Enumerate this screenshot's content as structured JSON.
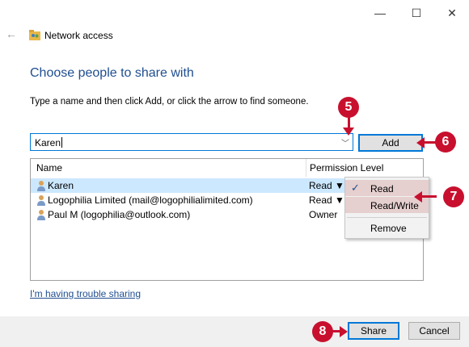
{
  "window": {
    "title": "Network access",
    "controls": {
      "minimize": "—",
      "maximize": "☐",
      "close": "✕"
    }
  },
  "heading": "Choose people to share with",
  "instruction": "Type a name and then click Add, or click the arrow to find someone.",
  "name_input": {
    "value": "Karen"
  },
  "add_button": "Add",
  "list": {
    "columns": [
      "Name",
      "Permission Level"
    ],
    "rows": [
      {
        "name": "Karen",
        "permission": "Read ▼"
      },
      {
        "name": "Logophilia Limited (mail@logophilialimited.com)",
        "permission": "Read ▼"
      },
      {
        "name": "Paul M (logophilia@outlook.com)",
        "permission": "Owner"
      }
    ]
  },
  "permission_menu": {
    "items": [
      "Read",
      "Read/Write",
      "Remove"
    ],
    "checked": "Read"
  },
  "trouble_link": "I'm having trouble sharing",
  "footer": {
    "share": "Share",
    "cancel": "Cancel"
  },
  "callouts": [
    "5",
    "6",
    "7",
    "8"
  ],
  "colors": {
    "accent": "#0078d7",
    "callout": "#c8102e",
    "heading": "#1f4e8f",
    "selection": "#cce8ff"
  }
}
